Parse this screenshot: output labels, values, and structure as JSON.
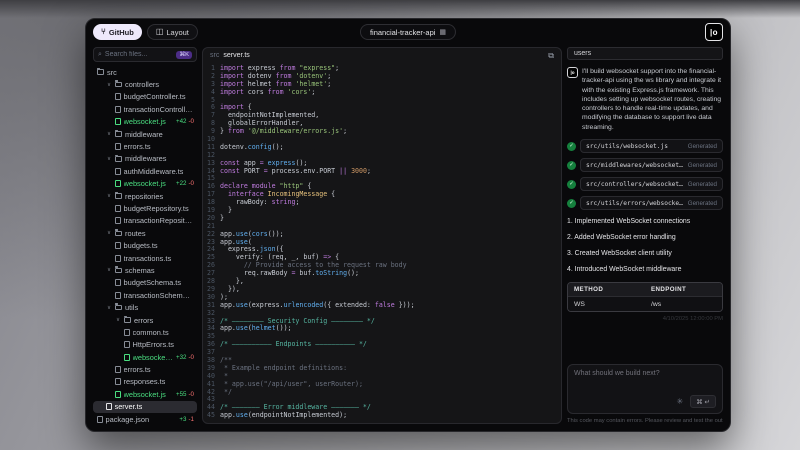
{
  "window": {
    "title": "financial-tracker-api"
  },
  "icons": {
    "github": "⑂",
    "layout": "◫",
    "project": "▦",
    "search": "⌕",
    "copy": "⧉",
    "check": "✓",
    "sparkle": "✳",
    "caret": "∨",
    "logo": "|o"
  },
  "topbar": {
    "github_label": "GitHub",
    "layout_label": "Layout",
    "logo_text": "|o"
  },
  "sidebar": {
    "search_placeholder": "Search files...",
    "search_shortcut": "⌘K",
    "tree": [
      {
        "name": "src",
        "kind": "folder",
        "depth": 0,
        "caret": false
      },
      {
        "name": "controllers",
        "kind": "folder",
        "depth": 1,
        "caret": true
      },
      {
        "name": "budgetController.ts",
        "kind": "file",
        "depth": 2
      },
      {
        "name": "transactionController.ts",
        "kind": "file",
        "depth": 2
      },
      {
        "name": "websocket.js",
        "kind": "file",
        "depth": 2,
        "added": true,
        "add": "+42",
        "del": "-0"
      },
      {
        "name": "middleware",
        "kind": "folder",
        "depth": 1,
        "caret": true
      },
      {
        "name": "errors.ts",
        "kind": "file",
        "depth": 2
      },
      {
        "name": "middlewares",
        "kind": "folder",
        "depth": 1,
        "caret": true
      },
      {
        "name": "authMiddleware.ts",
        "kind": "file",
        "depth": 2
      },
      {
        "name": "websocket.js",
        "kind": "file",
        "depth": 2,
        "added": true,
        "add": "+22",
        "del": "-0"
      },
      {
        "name": "repositories",
        "kind": "folder",
        "depth": 1,
        "caret": true
      },
      {
        "name": "budgetRepository.ts",
        "kind": "file",
        "depth": 2
      },
      {
        "name": "transactionRepository.ts",
        "kind": "file",
        "depth": 2
      },
      {
        "name": "routes",
        "kind": "folder",
        "depth": 1,
        "caret": true
      },
      {
        "name": "budgets.ts",
        "kind": "file",
        "depth": 2
      },
      {
        "name": "transactions.ts",
        "kind": "file",
        "depth": 2
      },
      {
        "name": "schemas",
        "kind": "folder",
        "depth": 1,
        "caret": true
      },
      {
        "name": "budgetSchema.ts",
        "kind": "file",
        "depth": 2
      },
      {
        "name": "transactionSchema.ts",
        "kind": "file",
        "depth": 2
      },
      {
        "name": "utils",
        "kind": "folder",
        "depth": 1,
        "caret": true
      },
      {
        "name": "errors",
        "kind": "folder",
        "depth": 2,
        "caret": true
      },
      {
        "name": "common.ts",
        "kind": "file",
        "depth": 3
      },
      {
        "name": "HttpErrors.ts",
        "kind": "file",
        "depth": 3
      },
      {
        "name": "websocket.js",
        "kind": "file",
        "depth": 3,
        "added": true,
        "add": "+32",
        "del": "-0"
      },
      {
        "name": "errors.ts",
        "kind": "file",
        "depth": 2
      },
      {
        "name": "responses.ts",
        "kind": "file",
        "depth": 2
      },
      {
        "name": "websocket.js",
        "kind": "file",
        "depth": 2,
        "added": true,
        "add": "+55",
        "del": "-0"
      },
      {
        "name": "server.ts",
        "kind": "file",
        "depth": 1,
        "selected": true
      },
      {
        "name": "package.json",
        "kind": "file",
        "depth": 0,
        "add": "+3",
        "del": "-1"
      }
    ]
  },
  "editor": {
    "breadcrumb_dir": "src",
    "breadcrumb_file": "server.ts",
    "lines": [
      [
        [
          "k",
          "import "
        ],
        [
          "p",
          "express "
        ],
        [
          "k",
          "from "
        ],
        [
          "s",
          "\"express\""
        ],
        [
          "p",
          ";"
        ]
      ],
      [
        [
          "k",
          "import "
        ],
        [
          "p",
          "dotenv "
        ],
        [
          "k",
          "from "
        ],
        [
          "s",
          "'dotenv'"
        ],
        [
          "p",
          ";"
        ]
      ],
      [
        [
          "k",
          "import "
        ],
        [
          "p",
          "helmet "
        ],
        [
          "k",
          "from "
        ],
        [
          "s",
          "'helmet'"
        ],
        [
          "p",
          ";"
        ]
      ],
      [
        [
          "k",
          "import "
        ],
        [
          "p",
          "cors "
        ],
        [
          "k",
          "from "
        ],
        [
          "s",
          "'cors'"
        ],
        [
          "p",
          ";"
        ]
      ],
      [],
      [
        [
          "k",
          "import "
        ],
        [
          "p",
          "{"
        ]
      ],
      [
        [
          "p",
          "  endpointNotImplemented,"
        ]
      ],
      [
        [
          "p",
          "  globalErrorHandler,"
        ]
      ],
      [
        [
          "p",
          "} "
        ],
        [
          "k",
          "from "
        ],
        [
          "s",
          "'@/middleware/errors.js'"
        ],
        [
          "p",
          ";"
        ]
      ],
      [],
      [
        [
          "p",
          "dotenv."
        ],
        [
          "f",
          "config"
        ],
        [
          "p",
          "();"
        ]
      ],
      [],
      [
        [
          "k",
          "const "
        ],
        [
          "p",
          "app "
        ],
        [
          "k",
          "= "
        ],
        [
          "f",
          "express"
        ],
        [
          "p",
          "();"
        ]
      ],
      [
        [
          "k",
          "const "
        ],
        [
          "p",
          "PORT "
        ],
        [
          "k",
          "= "
        ],
        [
          "p",
          "process.env.PORT "
        ],
        [
          "k",
          "|| "
        ],
        [
          "n",
          "3000"
        ],
        [
          "p",
          ";"
        ]
      ],
      [],
      [
        [
          "k",
          "declare module "
        ],
        [
          "s",
          "\"http\""
        ],
        [
          "p",
          " {"
        ]
      ],
      [
        [
          "p",
          "  "
        ],
        [
          "k",
          "interface "
        ],
        [
          "t",
          "IncomingMessage"
        ],
        [
          "p",
          " {"
        ]
      ],
      [
        [
          "p",
          "    rawBody: "
        ],
        [
          "k",
          "string"
        ],
        [
          "p",
          ";"
        ]
      ],
      [
        [
          "p",
          "  }"
        ]
      ],
      [
        [
          "p",
          "}"
        ]
      ],
      [],
      [
        [
          "p",
          "app."
        ],
        [
          "f",
          "use"
        ],
        [
          "p",
          "("
        ],
        [
          "f",
          "cors"
        ],
        [
          "p",
          "());"
        ]
      ],
      [
        [
          "p",
          "app."
        ],
        [
          "f",
          "use"
        ],
        [
          "p",
          "("
        ]
      ],
      [
        [
          "p",
          "  express."
        ],
        [
          "f",
          "json"
        ],
        [
          "p",
          "({"
        ]
      ],
      [
        [
          "p",
          "    verify: (req, _, buf) "
        ],
        [
          "k",
          "=> "
        ],
        [
          "p",
          "{"
        ]
      ],
      [
        [
          "c",
          "      // Provide access to the request raw body"
        ]
      ],
      [
        [
          "p",
          "      req.rawBody "
        ],
        [
          "k",
          "= "
        ],
        [
          "p",
          "buf."
        ],
        [
          "f",
          "toString"
        ],
        [
          "p",
          "();"
        ]
      ],
      [
        [
          "p",
          "    },"
        ]
      ],
      [
        [
          "p",
          "  }),"
        ]
      ],
      [
        [
          "p",
          ");"
        ]
      ],
      [
        [
          "p",
          "app."
        ],
        [
          "f",
          "use"
        ],
        [
          "p",
          "(express."
        ],
        [
          "f",
          "urlencoded"
        ],
        [
          "p",
          "({ extended: "
        ],
        [
          "k",
          "false"
        ],
        [
          "p",
          " }));"
        ]
      ],
      [],
      [
        [
          "g",
          "/* ———————— Security Config ———————— */"
        ]
      ],
      [
        [
          "p",
          "app."
        ],
        [
          "f",
          "use"
        ],
        [
          "p",
          "("
        ],
        [
          "f",
          "helmet"
        ],
        [
          "p",
          "());"
        ]
      ],
      [],
      [
        [
          "g",
          "/* —————————— Endpoints —————————— */"
        ]
      ],
      [],
      [
        [
          "c",
          "/**"
        ]
      ],
      [
        [
          "c",
          " * Example endpoint definitions:"
        ]
      ],
      [
        [
          "c",
          " *"
        ]
      ],
      [
        [
          "c",
          " * app.use(\"/api/user\", userRouter);"
        ]
      ],
      [
        [
          "c",
          " */"
        ]
      ],
      [],
      [
        [
          "g",
          "/* ——————— Error middleware ——————— */"
        ]
      ],
      [
        [
          "p",
          "app."
        ],
        [
          "f",
          "use"
        ],
        [
          "p",
          "(endpointNotImplemented);"
        ]
      ]
    ]
  },
  "assistant": {
    "tab_label": "users",
    "message": "I'll build websocket support into the financial-tracker-api using the ws library and integrate it with the existing Express.js framework. This includes setting up websocket routes, creating controllers to handle real-time updates, and modifying the database to support live data streaming.",
    "files": [
      {
        "path": "src/utils/websocket.js",
        "status": "Generated"
      },
      {
        "path": "src/middlewares/websocket.js",
        "status": "Generated"
      },
      {
        "path": "src/controllers/websocket.js",
        "status": "Generated"
      },
      {
        "path": "src/utils/errors/websocket.js",
        "status": "Generated"
      }
    ],
    "steps": [
      "1. Implemented WebSocket connections",
      "2. Added WebSocket error handling",
      "3. Created WebSocket client utility",
      "4. Introduced WebSocket middleware"
    ],
    "table": {
      "headers": [
        "METHOD",
        "ENDPOINT"
      ],
      "rows": [
        [
          "WS",
          "/ws"
        ]
      ]
    },
    "timestamp": "4/10/2025 12:00:00 PM",
    "input_placeholder": "What should we build next?",
    "send_shortcut": "⌘ ↵",
    "disclaimer": "This code may contain errors. Please review and test the output."
  },
  "colors": {
    "added_green": "#4ade80",
    "removed_red": "#f87171",
    "check_green": "#15803d",
    "accent_purple": "#4c2d87",
    "editor_bg": "#151517",
    "window_bg": "#09090b"
  }
}
